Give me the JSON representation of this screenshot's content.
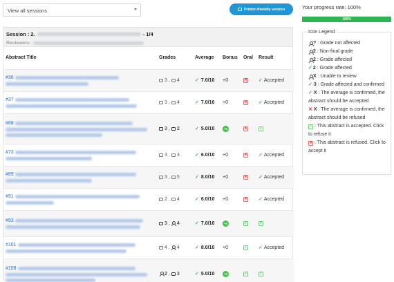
{
  "topbar": {
    "session_select": "View all sessions",
    "print_button": "Printer-friendly version"
  },
  "session": {
    "label": "Session : 2.",
    "counter": "- 1/4",
    "reviewers_label": "Reviewers:"
  },
  "table": {
    "headers": [
      "Abstract Title",
      "Grades",
      "Average",
      "Bonus",
      "Oral",
      "Result"
    ],
    "rows": [
      {
        "id": "#36",
        "grade_a": "3",
        "grade_b": "4",
        "average": "7.0/10",
        "bonus": "+0",
        "oral": "x",
        "result": "Accepted"
      },
      {
        "id": "#37",
        "grade_a": "3",
        "grade_b": "4",
        "average": "7.0/10",
        "bonus": "+0",
        "oral": "x",
        "result": "Accepted"
      },
      {
        "id": "#68",
        "grade_a": "3",
        "grade_b": "2",
        "average": "5.0/10",
        "bonus": "badge",
        "oral": "x",
        "result": ""
      },
      {
        "id": "#73",
        "grade_a": "3",
        "grade_b": "3",
        "average": "6.0/10",
        "bonus": "+0",
        "oral": "x",
        "result": "Accepted"
      },
      {
        "id": "#89",
        "grade_a": "3",
        "grade_b": "5",
        "average": "8.0/10",
        "bonus": "+0",
        "oral": "x",
        "result": "Accepted"
      },
      {
        "id": "#91",
        "grade_a": "2",
        "grade_b": "4",
        "average": "6.0/10",
        "bonus": "+0",
        "oral": "x",
        "result": "Accepted"
      },
      {
        "id": "#93",
        "grade_a": "3",
        "grade_b": "4",
        "average": "7.0/10",
        "bonus": "badge",
        "oral": "check",
        "result": ""
      },
      {
        "id": "#101",
        "grade_a": "4",
        "grade_b": "4",
        "average": "8.0/10",
        "bonus": "+0",
        "oral": "check",
        "result": "Accepted"
      },
      {
        "id": "#108",
        "grade_a": "2",
        "grade_b": "3",
        "average": "5.0/10",
        "bonus": "badge",
        "oral": "check",
        "result": ""
      }
    ]
  },
  "progress": {
    "label": "Your progress rate: 100%",
    "bar_text": "100%",
    "value": 1.0,
    "color": "#2db551"
  },
  "legend": {
    "title": "Icon Legend",
    "items": [
      {
        "value": "?",
        "text": ": Grade not affected"
      },
      {
        "value": "2",
        "text": ": Non-final grade"
      },
      {
        "value": "2",
        "text": ": Grade affected"
      },
      {
        "value": "2",
        "text": ": Grade affected"
      },
      {
        "value": "X",
        "text": ": Unable to review"
      },
      {
        "value": "3",
        "text": ": Grade affected and confirmed"
      },
      {
        "value": "X",
        "text": ": The average is confirmed, the abstract should be accepted"
      },
      {
        "value": "X",
        "text": ": The average is confirmed, the abstract should be refused"
      },
      {
        "text": ": This abstract is accepted. Click to refuse it"
      },
      {
        "text": ": This abstract is refused. Click to accept it"
      }
    ]
  },
  "colors": {
    "accent": "#1e97d6",
    "link": "#1e6fd0",
    "success": "#43a047",
    "danger": "#e53935"
  }
}
